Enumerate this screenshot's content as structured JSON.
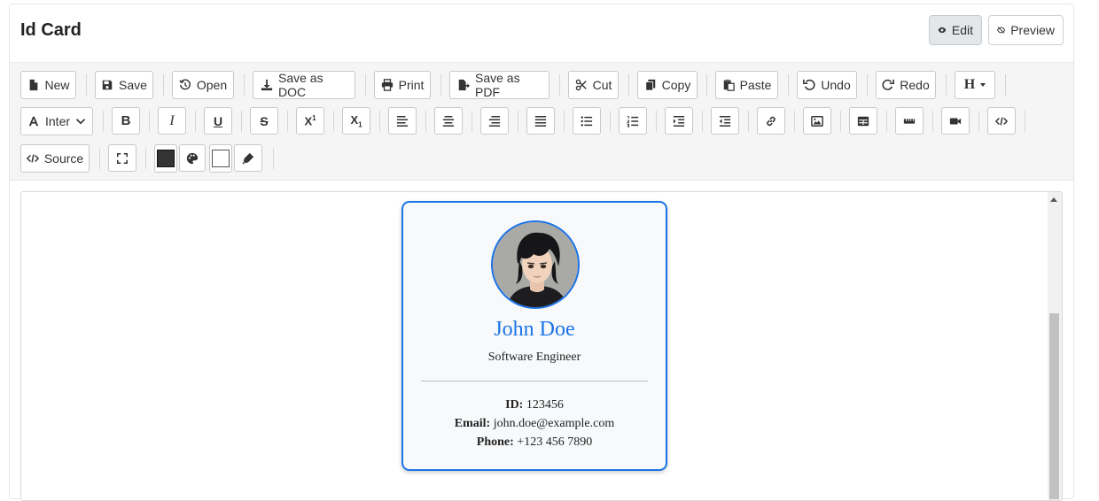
{
  "header": {
    "title": "Id Card",
    "edit_label": "Edit",
    "preview_label": "Preview"
  },
  "toolbar": {
    "row1": [
      {
        "label": "New",
        "icon": "file-icon"
      },
      {
        "label": "Save",
        "icon": "floppy-icon"
      },
      {
        "label": "Open",
        "icon": "history-icon"
      },
      {
        "label": "Save as DOC",
        "icon": "download-icon"
      },
      {
        "label": "Print",
        "icon": "printer-icon"
      },
      {
        "label": "Save as PDF",
        "icon": "file-export-icon"
      },
      {
        "label": "Cut",
        "icon": "scissors-icon"
      },
      {
        "label": "Copy",
        "icon": "copy-icon"
      },
      {
        "label": "Paste",
        "icon": "paste-icon"
      },
      {
        "label": "Undo",
        "icon": "undo-icon"
      },
      {
        "label": "Redo",
        "icon": "redo-icon"
      }
    ],
    "heading_label": "H",
    "font_label": "Inter",
    "source_label": "Source",
    "text_color": "#333333",
    "bg_color": "#ffffff"
  },
  "card": {
    "name": "John Doe",
    "role": "Software Engineer",
    "id_label": "ID:",
    "id_value": "123456",
    "email_label": "Email:",
    "email_value": "john.doe@example.com",
    "phone_label": "Phone:",
    "phone_value": "+123 456 7890",
    "accent": "#1a73e8"
  }
}
